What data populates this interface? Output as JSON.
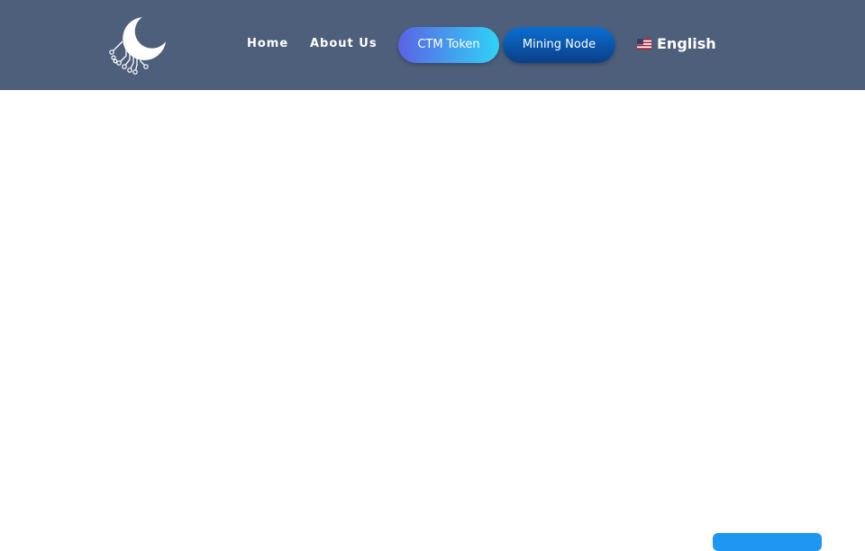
{
  "header": {
    "logo_icon": "moon-circuit-logo-icon",
    "nav": {
      "home_label": "Home",
      "about_label": "About Us",
      "ctm_token_label": "CTM Token",
      "mining_node_label": "Mining Node"
    },
    "language": {
      "flag_icon": "us-flag-icon",
      "label": "English"
    }
  },
  "colors": {
    "navbar_bg": "#4e5f7b",
    "ctm_gradient_start": "#5a63e6",
    "ctm_gradient_end": "#2fd3f6",
    "mining_gradient_start": "#0a6ed1",
    "mining_gradient_end": "#0a3f86",
    "floating_button": "#1e97f3",
    "page_bg": "#ffffff"
  }
}
